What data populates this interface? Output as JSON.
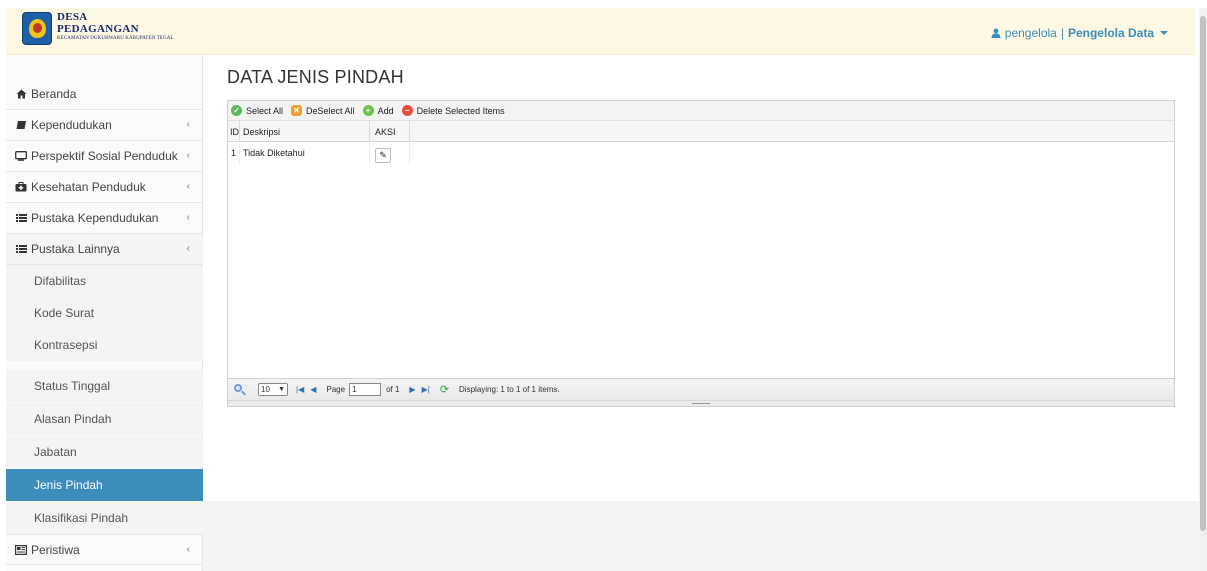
{
  "header": {
    "logo_line1": "DESA",
    "logo_line2": "PEDAGANGAN",
    "logo_line3": "KECAMATAN DUKUHWARU KABUPATEN TEGAL",
    "user_name": "pengelola",
    "separator": "|",
    "user_role": "Pengelola Data"
  },
  "sidebar": {
    "items": [
      {
        "label": "Beranda",
        "icon": "home-icon"
      },
      {
        "label": "Kependudukan",
        "icon": "book-icon"
      },
      {
        "label": "Perspektif Sosial Penduduk",
        "icon": "monitor-icon"
      },
      {
        "label": "Kesehatan Penduduk",
        "icon": "medkit-icon"
      },
      {
        "label": "Pustaka Kependudukan",
        "icon": "list-icon"
      },
      {
        "label": "Pustaka Lainnya",
        "icon": "list-icon"
      },
      {
        "label": "Peristiwa",
        "icon": "newspaper-icon"
      }
    ],
    "sub_items": [
      {
        "label": "Difabilitas"
      },
      {
        "label": "Kode Surat"
      },
      {
        "label": "Kontrasepsi"
      },
      {
        "label": "Status Tinggal"
      },
      {
        "label": "Alasan Pindah"
      },
      {
        "label": "Jabatan"
      },
      {
        "label": "Jenis Pindah"
      },
      {
        "label": "Klasifikasi Pindah"
      }
    ]
  },
  "page": {
    "title": "DATA JENIS PINDAH"
  },
  "toolbar": {
    "select_all": "Select All",
    "deselect_all": "DeSelect All",
    "add": "Add",
    "delete_selected": "Delete Selected Items"
  },
  "table": {
    "columns": [
      "ID",
      "Deskripsi",
      "AKSI"
    ],
    "rows": [
      {
        "id": "1",
        "deskripsi": "Tidak Diketahui"
      }
    ]
  },
  "pager": {
    "page_size": "10",
    "page_label": "Page",
    "page_value": "1",
    "of_label": "of 1",
    "displaying": "Displaying: 1 to 1 of 1 items."
  },
  "colors": {
    "accent": "#3c8dbc",
    "header_bg": "#fcf8e3",
    "sidebar_bg": "#f9fafc"
  }
}
